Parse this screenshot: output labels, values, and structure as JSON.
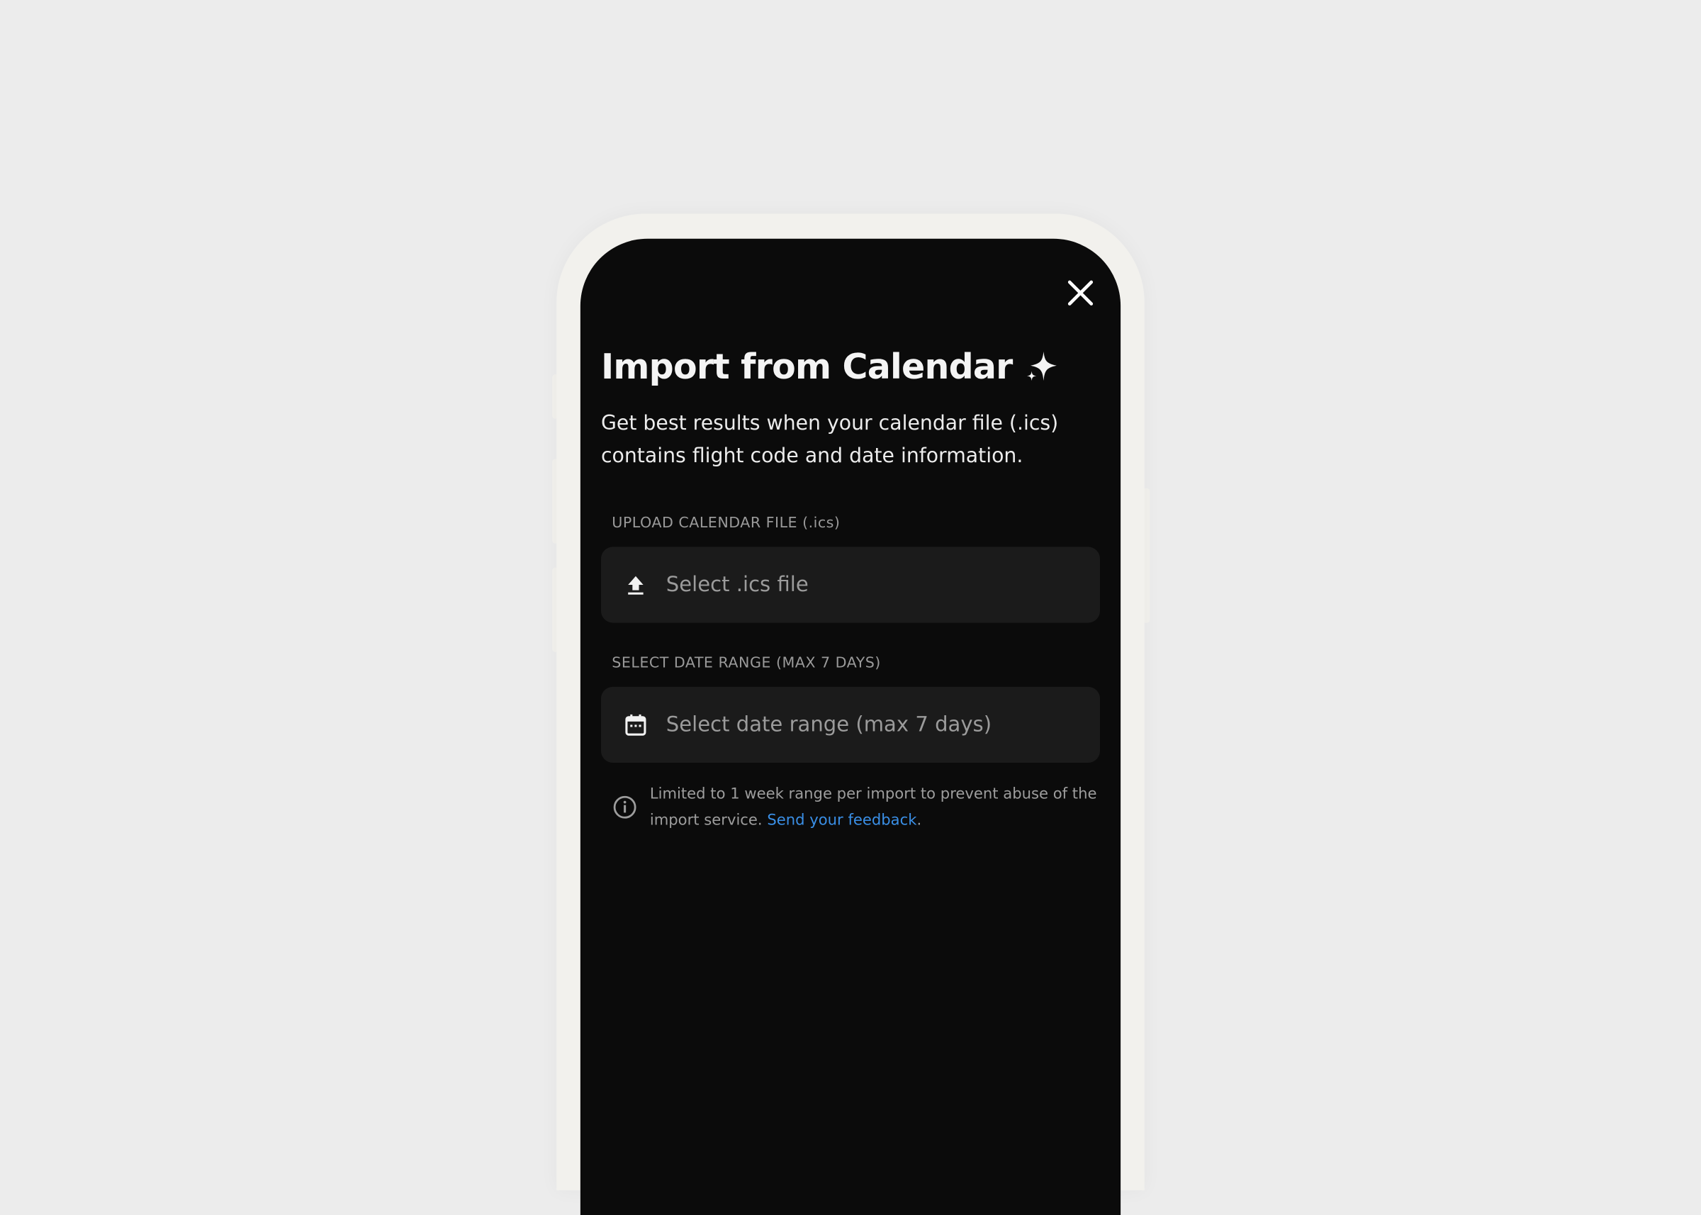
{
  "modal": {
    "title": "Import from Calendar",
    "subtitle": "Get best results when your calendar file (.ics) contains flight code and date information."
  },
  "upload": {
    "label": "UPLOAD CALENDAR FILE (.ics)",
    "placeholder": "Select .ics file"
  },
  "date_range": {
    "label": "SELECT DATE RANGE (MAX 7 DAYS)",
    "placeholder": "Select date range (max 7 days)"
  },
  "info": {
    "text": "Limited to 1 week range per import to prevent abuse of the import service. ",
    "link_label": "Send your feedback",
    "trailing": "."
  },
  "colors": {
    "background": "#ececec",
    "phone_frame": "#f2f1ed",
    "screen": "#0b0b0b",
    "field": "#1b1b1b",
    "link": "#3a8fe6"
  },
  "icons": {
    "close": "close-icon",
    "sparkle": "sparkle-icon",
    "upload": "upload-icon",
    "calendar": "calendar-icon",
    "info": "info-icon"
  }
}
